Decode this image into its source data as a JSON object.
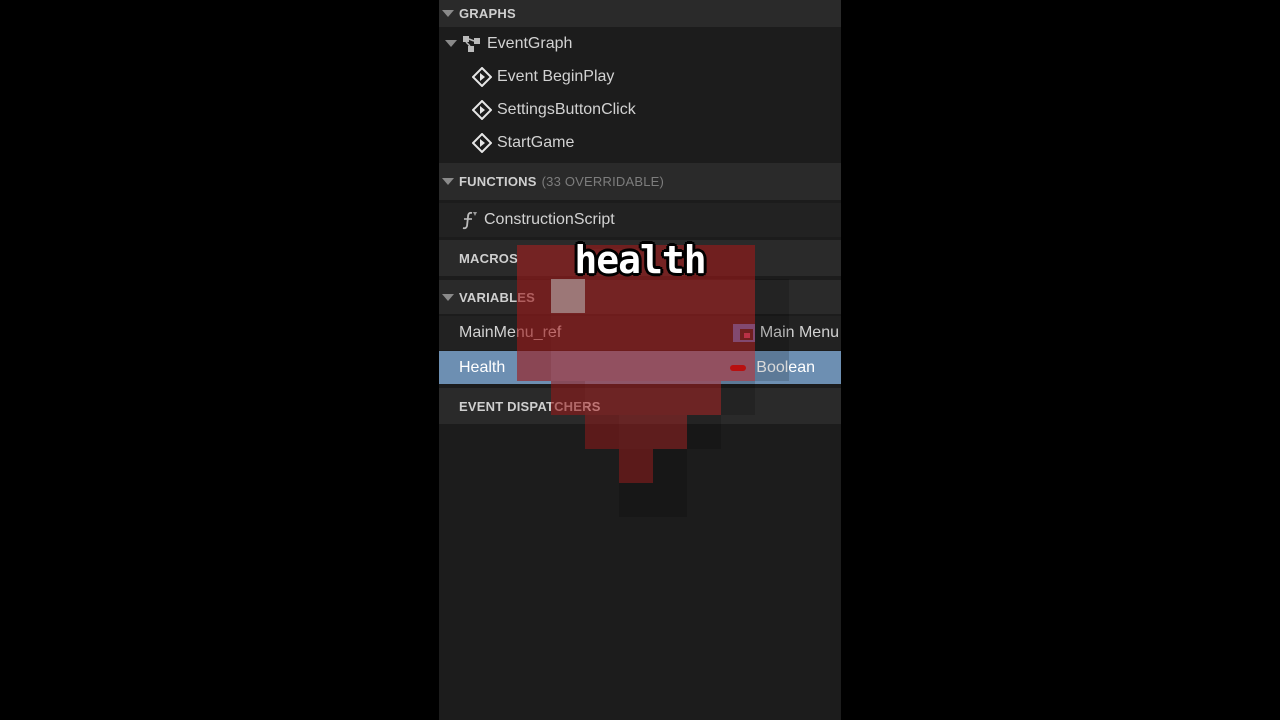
{
  "sections": {
    "graphs": {
      "label": "GRAPHS"
    },
    "functions": {
      "label": "FUNCTIONS",
      "sub": "(33 OVERRIDABLE)"
    },
    "macros": {
      "label": "MACROS"
    },
    "variables": {
      "label": "VARIABLES"
    },
    "dispatchers": {
      "label": "EVENT DISPATCHERS"
    }
  },
  "graph": {
    "name": "EventGraph",
    "events": [
      {
        "label": "Event BeginPlay"
      },
      {
        "label": "SettingsButtonClick"
      },
      {
        "label": "StartGame"
      }
    ]
  },
  "functions": {
    "items": [
      {
        "label": "ConstructionScript"
      }
    ]
  },
  "variables": {
    "items": [
      {
        "name": "MainMenu_ref",
        "type": "Main Menu"
      },
      {
        "name": "Health",
        "type": "Boolean",
        "selected": true
      }
    ]
  },
  "overlay": {
    "caption": "health"
  },
  "colors": {
    "selected": "#6d8fb2",
    "boolean": "#c00000",
    "heart": "#b01e1e",
    "object": "#4a7fd4"
  }
}
